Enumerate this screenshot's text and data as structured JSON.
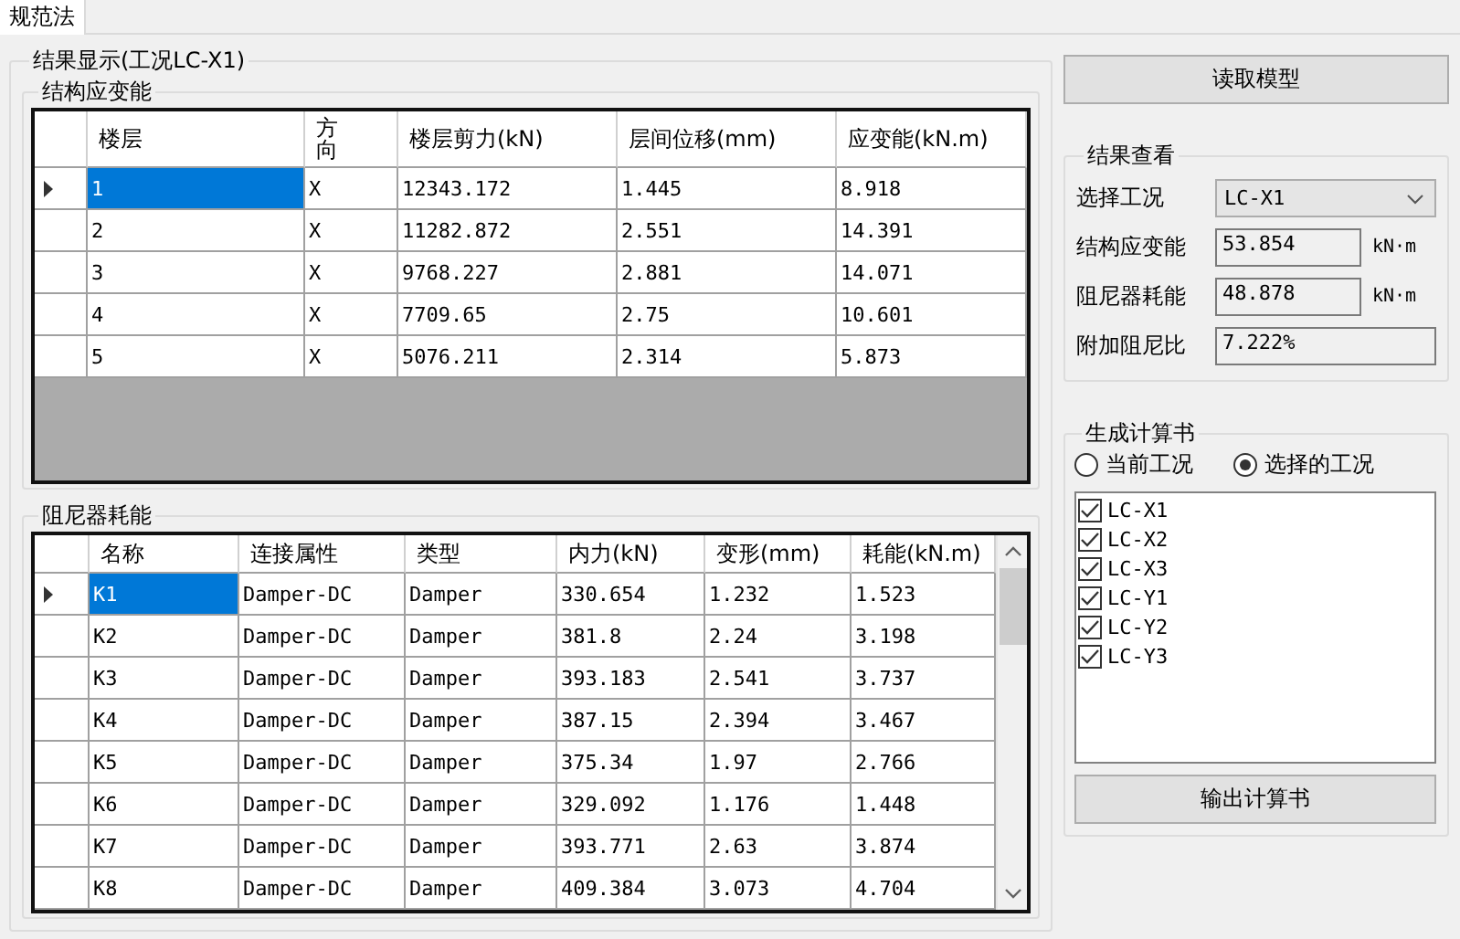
{
  "tabs": [
    {
      "label": "规范法",
      "selected": true
    }
  ],
  "results": {
    "title": "结果显示(工况LC-X1)",
    "strain_energy": {
      "title": "结构应变能",
      "columns": [
        "楼层",
        "方向",
        "楼层剪力(kN)",
        "层间位移(mm)",
        "应变能(kN.m)"
      ],
      "rows": [
        {
          "selected": true,
          "cells": [
            "1",
            "X",
            "12343.172",
            "1.445",
            "8.918"
          ]
        },
        {
          "selected": false,
          "cells": [
            "2",
            "X",
            "11282.872",
            "2.551",
            "14.391"
          ]
        },
        {
          "selected": false,
          "cells": [
            "3",
            "X",
            "9768.227",
            "2.881",
            "14.071"
          ]
        },
        {
          "selected": false,
          "cells": [
            "4",
            "X",
            "7709.65",
            "2.75",
            "10.601"
          ]
        },
        {
          "selected": false,
          "cells": [
            "5",
            "X",
            "5076.211",
            "2.314",
            "5.873"
          ]
        }
      ]
    },
    "damper_energy": {
      "title": "阻尼器耗能",
      "columns": [
        "名称",
        "连接属性",
        "类型",
        "内力(kN)",
        "变形(mm)",
        "耗能(kN.m)"
      ],
      "rows": [
        {
          "selected": true,
          "cells": [
            "K1",
            "Damper-DC",
            "Damper",
            "330.654",
            "1.232",
            "1.523"
          ]
        },
        {
          "selected": false,
          "cells": [
            "K2",
            "Damper-DC",
            "Damper",
            "381.8",
            "2.24",
            "3.198"
          ]
        },
        {
          "selected": false,
          "cells": [
            "K3",
            "Damper-DC",
            "Damper",
            "393.183",
            "2.541",
            "3.737"
          ]
        },
        {
          "selected": false,
          "cells": [
            "K4",
            "Damper-DC",
            "Damper",
            "387.15",
            "2.394",
            "3.467"
          ]
        },
        {
          "selected": false,
          "cells": [
            "K5",
            "Damper-DC",
            "Damper",
            "375.34",
            "1.97",
            "2.766"
          ]
        },
        {
          "selected": false,
          "cells": [
            "K6",
            "Damper-DC",
            "Damper",
            "329.092",
            "1.176",
            "1.448"
          ]
        },
        {
          "selected": false,
          "cells": [
            "K7",
            "Damper-DC",
            "Damper",
            "393.771",
            "2.63",
            "3.874"
          ]
        },
        {
          "selected": false,
          "cells": [
            "K8",
            "Damper-DC",
            "Damper",
            "409.384",
            "3.073",
            "4.704"
          ]
        }
      ]
    }
  },
  "read_model_button": "读取模型",
  "result_view": {
    "title": "结果查看",
    "case_label": "选择工况",
    "case_value": "LC-X1",
    "fields": [
      {
        "label": "结构应变能",
        "value": "53.854",
        "unit": "kN·m"
      },
      {
        "label": "阻尼器耗能",
        "value": "48.878",
        "unit": "kN·m"
      },
      {
        "label": "附加阻尼比",
        "value": "7.222%"
      }
    ]
  },
  "report": {
    "title": "生成计算书",
    "options": [
      {
        "label": "当前工况",
        "selected": false
      },
      {
        "label": "选择的工况",
        "selected": true
      }
    ],
    "cases": [
      {
        "label": "LC-X1",
        "checked": true
      },
      {
        "label": "LC-X2",
        "checked": true
      },
      {
        "label": "LC-X3",
        "checked": true
      },
      {
        "label": "LC-Y1",
        "checked": true
      },
      {
        "label": "LC-Y2",
        "checked": true
      },
      {
        "label": "LC-Y3",
        "checked": true
      }
    ],
    "button": "输出计算书"
  }
}
